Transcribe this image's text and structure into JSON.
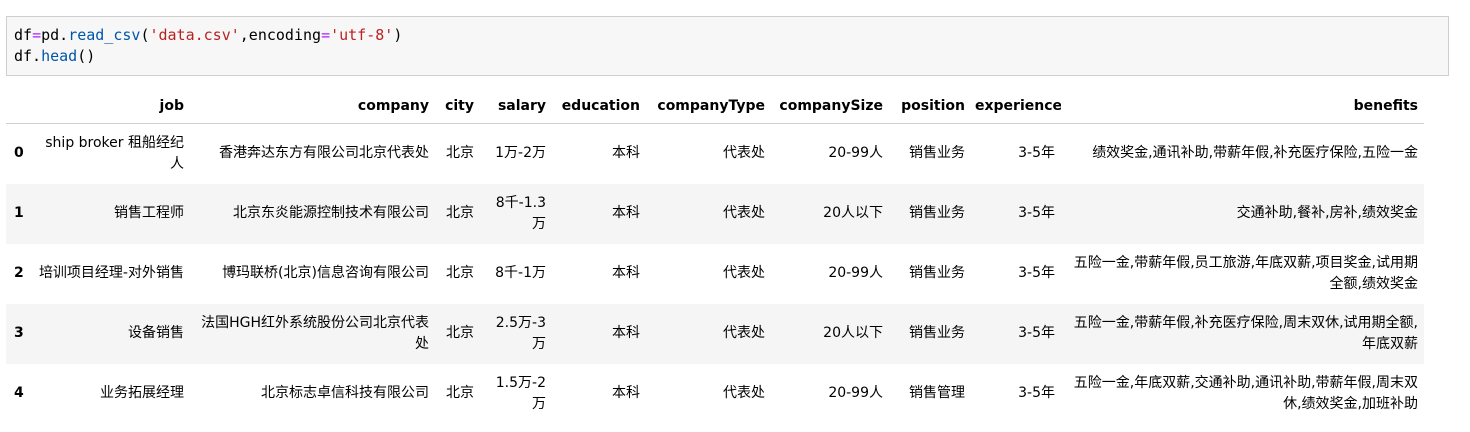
{
  "code": {
    "line1": {
      "var": "df",
      "op": "=",
      "obj": "pd.",
      "fn": "read_csv",
      "open": "(",
      "arg1": "'data.csv'",
      "comma": ",encoding",
      "eq": "=",
      "arg2": "'utf-8'",
      "close": ")"
    },
    "line2": {
      "obj": "df.",
      "fn": "head",
      "parens": "()"
    }
  },
  "table": {
    "columns": [
      "job",
      "company",
      "city",
      "salary",
      "education",
      "companyType",
      "companySize",
      "position",
      "experience",
      "benefits"
    ],
    "rows": [
      {
        "index": "0",
        "cells": [
          "ship broker 租船经纪人",
          "香港奔达东方有限公司北京代表处",
          "北京",
          "1万-2万",
          "本科",
          "代表处",
          "20-99人",
          "销售业务",
          "3-5年",
          "绩效奖金,通讯补助,带薪年假,补充医疗保险,五险一金"
        ]
      },
      {
        "index": "1",
        "cells": [
          "销售工程师",
          "北京东炎能源控制技术有限公司",
          "北京",
          "8千-1.3万",
          "本科",
          "代表处",
          "20人以下",
          "销售业务",
          "3-5年",
          "交通补助,餐补,房补,绩效奖金"
        ]
      },
      {
        "index": "2",
        "cells": [
          "培训项目经理-对外销售",
          "博玛联桥(北京)信息咨询有限公司",
          "北京",
          "8千-1万",
          "本科",
          "代表处",
          "20-99人",
          "销售业务",
          "3-5年",
          "五险一金,带薪年假,员工旅游,年底双薪,项目奖金,试用期全额,绩效奖金"
        ]
      },
      {
        "index": "3",
        "cells": [
          "设备销售",
          "法国HGH红外系统股份公司北京代表处",
          "北京",
          "2.5万-3万",
          "本科",
          "代表处",
          "20人以下",
          "销售业务",
          "3-5年",
          "五险一金,带薪年假,补充医疗保险,周末双休,试用期全额,年底双薪"
        ]
      },
      {
        "index": "4",
        "cells": [
          "业务拓展经理",
          "北京标志卓信科技有限公司",
          "北京",
          "1.5万-2万",
          "本科",
          "代表处",
          "20-99人",
          "销售管理",
          "3-5年",
          "五险一金,年底双薪,交通补助,通讯补助,带薪年假,周末双休,绩效奖金,加班补助"
        ]
      }
    ]
  }
}
